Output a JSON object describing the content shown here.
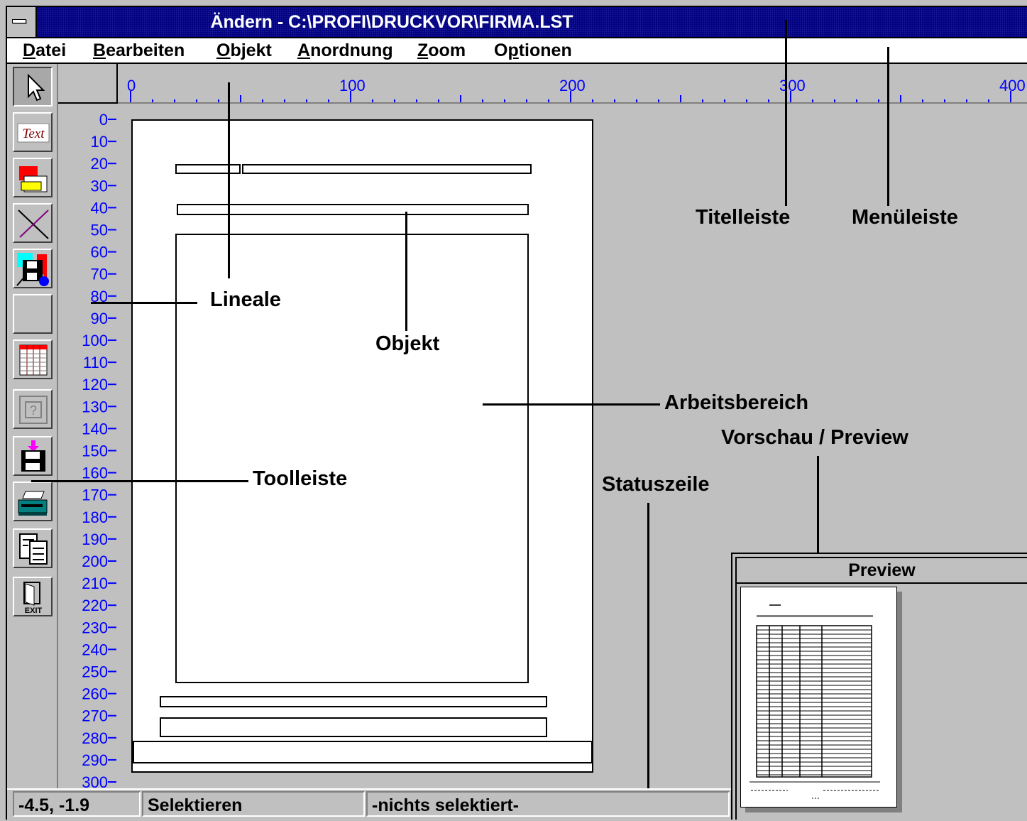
{
  "window": {
    "title": "Ändern  - C:\\PROFI\\DRUCKVOR\\FIRMA.LST"
  },
  "menu": {
    "items": [
      {
        "label": "Datei",
        "accel": "D"
      },
      {
        "label": "Bearbeiten",
        "accel": "B"
      },
      {
        "label": "Objekt",
        "accel": "O"
      },
      {
        "label": "Anordnung",
        "accel": "A"
      },
      {
        "label": "Zoom",
        "accel": "Z"
      },
      {
        "label": "Optionen",
        "accel": "p"
      }
    ]
  },
  "toolbar": {
    "tools": [
      {
        "icon": "pointer-icon"
      },
      {
        "icon": "text-tool-icon",
        "label": "Text"
      },
      {
        "icon": "rectangle-color-icon"
      },
      {
        "icon": "line-tool-icon"
      },
      {
        "icon": "save-image-icon"
      },
      {
        "icon": "blank-tool-icon"
      },
      {
        "icon": "table-tool-icon"
      },
      {
        "icon": "help-tool-icon"
      },
      {
        "icon": "save-disk-icon"
      },
      {
        "icon": "printer-icon"
      },
      {
        "icon": "preview-pages-icon"
      },
      {
        "icon": "exit-door-icon",
        "label": "EXIT"
      }
    ]
  },
  "ruler": {
    "top_labels": [
      "0",
      "100",
      "200",
      "300",
      "400"
    ],
    "left_labels": [
      "0",
      "10",
      "20",
      "30",
      "40",
      "50",
      "60",
      "70",
      "80",
      "90",
      "100",
      "110",
      "120",
      "130",
      "140",
      "150",
      "160",
      "170",
      "180",
      "190",
      "200",
      "210",
      "220",
      "230",
      "240",
      "250",
      "260",
      "270",
      "280",
      "290",
      "300"
    ]
  },
  "annotations": {
    "titelleiste": "Titelleiste",
    "menueleiste": "Menüleiste",
    "lineale": "Lineale",
    "objekt": "Objekt",
    "arbeitsbereich": "Arbeitsbereich",
    "vorschau": "Vorschau / Preview",
    "toolleiste": "Toolleiste",
    "statuszeile": "Statuszeile"
  },
  "preview": {
    "title": "Preview"
  },
  "status": {
    "coordinates": "-4.5, -1.9",
    "mode": "Selektieren",
    "selection": "-nichts selektiert-"
  },
  "colors": {
    "titlebar": "#00007f",
    "ruler_text": "#0000ff",
    "background": "#c0c0c0"
  }
}
